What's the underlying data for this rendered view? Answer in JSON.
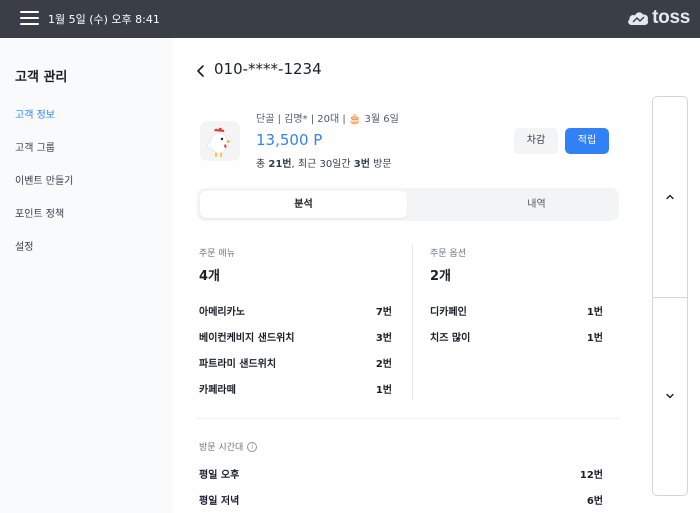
{
  "topbar": {
    "datetime": "1월 5일 (수) 오후 8:41",
    "logo_text": "toss"
  },
  "sidebar": {
    "title": "고객 관리",
    "items": [
      {
        "label": "고객 정보",
        "active": true
      },
      {
        "label": "고객 그룹",
        "active": false
      },
      {
        "label": "이벤트 만들기",
        "active": false
      },
      {
        "label": "포인트 정책",
        "active": false
      },
      {
        "label": "설정",
        "active": false
      }
    ]
  },
  "customer": {
    "phone": "010-****-1234",
    "meta": "단골 | 김명* | 20대 | 🎂 3월 6일",
    "points": "13,500 P",
    "visits_prefix": "총 ",
    "visits_total": "21번",
    "visits_mid": ", 최근 30일간 ",
    "visits_recent": "3번",
    "visits_suffix": " 방문"
  },
  "actions": {
    "deduct_label": "차감",
    "earn_label": "적립"
  },
  "tabs": [
    {
      "label": "분석",
      "active": true
    },
    {
      "label": "내역",
      "active": false
    }
  ],
  "analysis": {
    "menu": {
      "label": "주문 메뉴",
      "count": "4개",
      "rows": [
        {
          "name": "아메리카노",
          "value": "7번"
        },
        {
          "name": "베이컨케비지 샌드위치",
          "value": "3번"
        },
        {
          "name": "파트라미 샌드위치",
          "value": "2번"
        },
        {
          "name": "카페라떼",
          "value": "1번"
        }
      ]
    },
    "options": {
      "label": "주문 옵션",
      "count": "2개",
      "rows": [
        {
          "name": "디카페인",
          "value": "1번"
        },
        {
          "name": "치즈 많이",
          "value": "1번"
        }
      ]
    },
    "visit_time": {
      "label": "방문 시간대",
      "info_icon": "i",
      "rows": [
        {
          "name": "평일 오후",
          "value": "12번"
        },
        {
          "name": "평일 저녁",
          "value": "6번"
        }
      ]
    }
  },
  "colors": {
    "accent": "#3182f6",
    "topbar": "#3a3f47",
    "sidebar_bg": "#f9fafb"
  }
}
